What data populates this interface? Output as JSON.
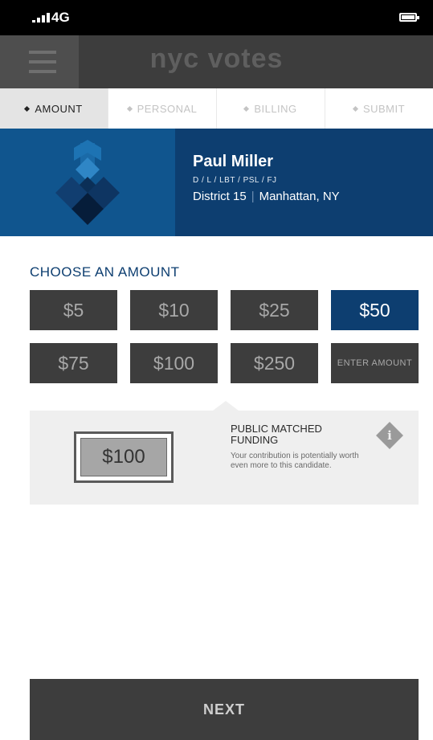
{
  "status_bar": {
    "network": "4G",
    "signal_icon": "signal-bars-icon",
    "battery_icon": "battery-icon"
  },
  "header": {
    "title": "nyc votes",
    "menu_icon": "hamburger-menu-icon"
  },
  "steps": [
    {
      "label": "AMOUNT",
      "active": true
    },
    {
      "label": "PERSONAL",
      "active": false
    },
    {
      "label": "BILLING",
      "active": false
    },
    {
      "label": "SUBMIT",
      "active": false
    }
  ],
  "candidate": {
    "name": "Paul Miller",
    "parties": "D / L / LBT / PSL / FJ",
    "district": "District 15",
    "location": "Manhattan, NY",
    "logo_icon": "diamond-logo-icon",
    "colors": {
      "panel": "#0d3e70",
      "logo_panel": "#10558e"
    }
  },
  "amount_section": {
    "title": "CHOOSE AN AMOUNT",
    "options": [
      {
        "label": "$5",
        "selected": false
      },
      {
        "label": "$10",
        "selected": false
      },
      {
        "label": "$25",
        "selected": false
      },
      {
        "label": "$50",
        "selected": true
      },
      {
        "label": "$75",
        "selected": false
      },
      {
        "label": "$100",
        "selected": false
      },
      {
        "label": "$250",
        "selected": false
      },
      {
        "label": "ENTER AMOUNT",
        "selected": false
      }
    ]
  },
  "match": {
    "amount": "$100",
    "title": "PUBLIC MATCHED FUNDING",
    "description": "Your contribution is potentially worth even more to this candidate.",
    "info_icon": "info-icon"
  },
  "next_label": "NEXT",
  "colors": {
    "accent": "#0d3e70",
    "dark": "#3d3d3d",
    "panel": "#efefef"
  }
}
